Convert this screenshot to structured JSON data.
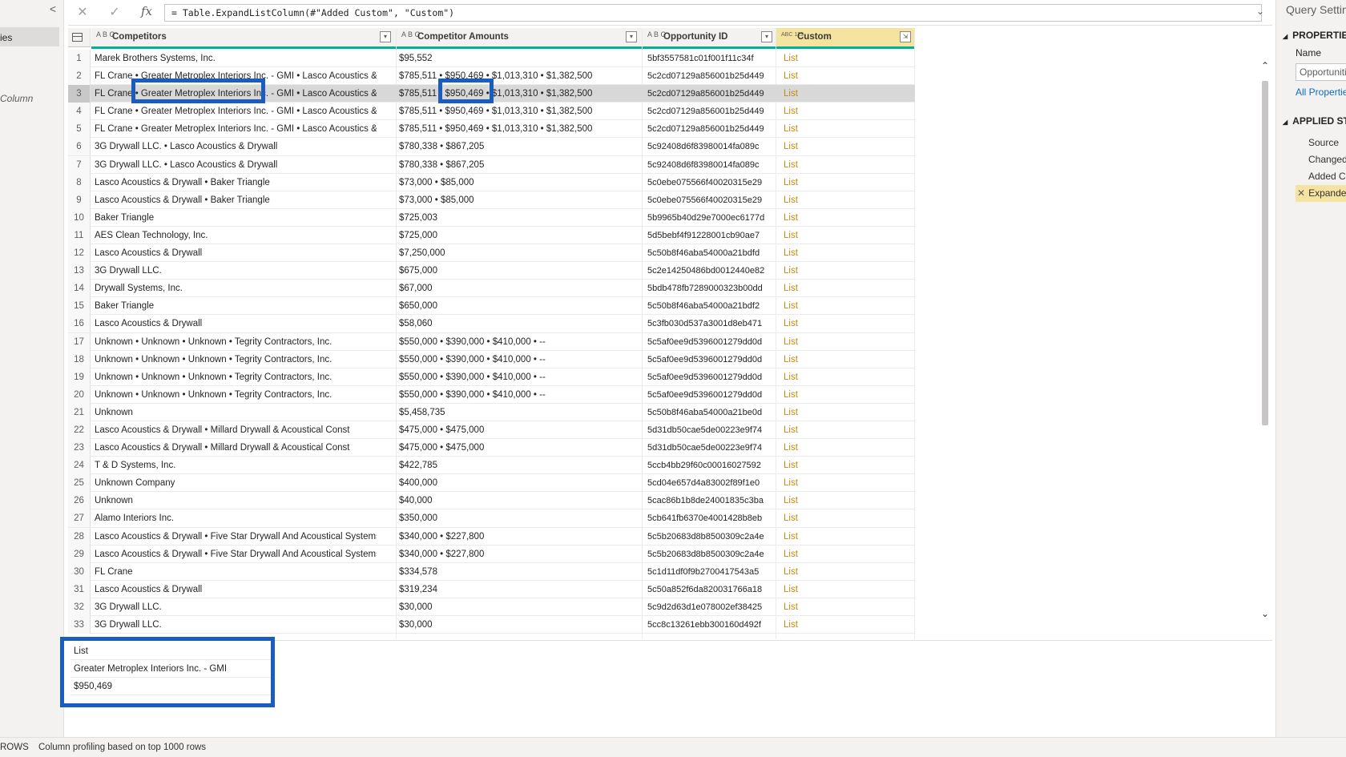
{
  "left_pane": {
    "collapse_glyph": "<",
    "partial_item": "ies",
    "partial_column": "Column"
  },
  "formula_bar": {
    "cancel_glyph": "✕",
    "commit_glyph": "✓",
    "fx_label": "fx",
    "formula": "= Table.ExpandListColumn(#\"Added Custom\", \"Custom\")",
    "expand_glyph": "⌄"
  },
  "columns": [
    {
      "name": "Competitors",
      "type_icon": "A B C",
      "bar_color": "#00b294"
    },
    {
      "name": "Competitor Amounts",
      "type_icon": "A B C",
      "bar_color": "#00b294"
    },
    {
      "name": "Opportunity ID",
      "type_icon": "A B C",
      "bar_color": "#00b294"
    },
    {
      "name": "Custom",
      "type_icon": "ABC 123",
      "bar_color": "#00b294",
      "header_bg": "#f5e3a0"
    }
  ],
  "rows": [
    {
      "idx": "1",
      "competitors": "Marek Brothers Systems, Inc.",
      "amounts": "$95,552",
      "opp_id": "5bf3557581c01f001f11c34f",
      "custom": "List"
    },
    {
      "idx": "2",
      "competitors": "FL Crane • Greater Metroplex Interiors  Inc. - GMI • Lasco Acoustics & ...",
      "amounts": "$785,511 • $950,469 • $1,013,310 • $1,382,500",
      "opp_id": "5c2cd07129a856001b25d449",
      "custom": "List"
    },
    {
      "idx": "3",
      "competitors": "FL Crane • Greater Metroplex Interiors  Inc. - GMI • Lasco Acoustics & ...",
      "amounts": "$785,511 • $950,469 • $1,013,310 • $1,382,500",
      "opp_id": "5c2cd07129a856001b25d449",
      "custom": "List"
    },
    {
      "idx": "4",
      "competitors": "FL Crane • Greater Metroplex Interiors  Inc. - GMI • Lasco Acoustics & ...",
      "amounts": "$785,511 • $950,469 • $1,013,310 • $1,382,500",
      "opp_id": "5c2cd07129a856001b25d449",
      "custom": "List"
    },
    {
      "idx": "5",
      "competitors": "FL Crane • Greater Metroplex Interiors  Inc. - GMI • Lasco Acoustics & ...",
      "amounts": "$785,511 • $950,469 • $1,013,310 • $1,382,500",
      "opp_id": "5c2cd07129a856001b25d449",
      "custom": "List"
    },
    {
      "idx": "6",
      "competitors": "3G Drywall LLC. • Lasco Acoustics & Drywall",
      "amounts": "$780,338 • $867,205",
      "opp_id": "5c92408d6f83980014fa089c",
      "custom": "List"
    },
    {
      "idx": "7",
      "competitors": "3G Drywall LLC. • Lasco Acoustics & Drywall",
      "amounts": "$780,338 • $867,205",
      "opp_id": "5c92408d6f83980014fa089c",
      "custom": "List"
    },
    {
      "idx": "8",
      "competitors": "Lasco Acoustics & Drywall • Baker Triangle",
      "amounts": "$73,000 • $85,000",
      "opp_id": "5c0ebe075566f40020315e29",
      "custom": "List"
    },
    {
      "idx": "9",
      "competitors": "Lasco Acoustics & Drywall • Baker Triangle",
      "amounts": "$73,000 • $85,000",
      "opp_id": "5c0ebe075566f40020315e29",
      "custom": "List"
    },
    {
      "idx": "10",
      "competitors": "Baker Triangle",
      "amounts": "$725,003",
      "opp_id": "5b9965b40d29e7000ec6177d",
      "custom": "List"
    },
    {
      "idx": "11",
      "competitors": "AES Clean Technology, Inc.",
      "amounts": "$725,000",
      "opp_id": "5d5bebf4f91228001cb90ae7",
      "custom": "List"
    },
    {
      "idx": "12",
      "competitors": "Lasco Acoustics & Drywall",
      "amounts": "$7,250,000",
      "opp_id": "5c50b8f46aba54000a21bdfd",
      "custom": "List"
    },
    {
      "idx": "13",
      "competitors": "3G Drywall LLC.",
      "amounts": "$675,000",
      "opp_id": "5c2e14250486bd0012440e82",
      "custom": "List"
    },
    {
      "idx": "14",
      "competitors": "Drywall Systems, Inc.",
      "amounts": "$67,000",
      "opp_id": "5bdb478fb7289000323b00dd",
      "custom": "List"
    },
    {
      "idx": "15",
      "competitors": "Baker Triangle",
      "amounts": "$650,000",
      "opp_id": "5c50b8f46aba54000a21bdf2",
      "custom": "List"
    },
    {
      "idx": "16",
      "competitors": "Lasco Acoustics & Drywall",
      "amounts": "$58,060",
      "opp_id": "5c3fb030d537a3001d8eb471",
      "custom": "List"
    },
    {
      "idx": "17",
      "competitors": "Unknown • Unknown • Unknown • Tegrity Contractors, Inc.",
      "amounts": "$550,000 • $390,000 • $410,000 • --",
      "opp_id": "5c5af0ee9d5396001279dd0d",
      "custom": "List"
    },
    {
      "idx": "18",
      "competitors": "Unknown • Unknown • Unknown • Tegrity Contractors, Inc.",
      "amounts": "$550,000 • $390,000 • $410,000 • --",
      "opp_id": "5c5af0ee9d5396001279dd0d",
      "custom": "List"
    },
    {
      "idx": "19",
      "competitors": "Unknown • Unknown • Unknown • Tegrity Contractors, Inc.",
      "amounts": "$550,000 • $390,000 • $410,000 • --",
      "opp_id": "5c5af0ee9d5396001279dd0d",
      "custom": "List"
    },
    {
      "idx": "20",
      "competitors": "Unknown • Unknown • Unknown • Tegrity Contractors, Inc.",
      "amounts": "$550,000 • $390,000 • $410,000 • --",
      "opp_id": "5c5af0ee9d5396001279dd0d",
      "custom": "List"
    },
    {
      "idx": "21",
      "competitors": "Unknown",
      "amounts": "$5,458,735",
      "opp_id": "5c50b8f46aba54000a21be0d",
      "custom": "List"
    },
    {
      "idx": "22",
      "competitors": "Lasco Acoustics & Drywall • Millard Drywall & Acoustical Const",
      "amounts": "$475,000 • $475,000",
      "opp_id": "5d31db50cae5de00223e9f74",
      "custom": "List"
    },
    {
      "idx": "23",
      "competitors": "Lasco Acoustics & Drywall • Millard Drywall & Acoustical Const",
      "amounts": "$475,000 • $475,000",
      "opp_id": "5d31db50cae5de00223e9f74",
      "custom": "List"
    },
    {
      "idx": "24",
      "competitors": "T & D Systems, Inc.",
      "amounts": "$422,785",
      "opp_id": "5ccb4bb29f60c00016027592",
      "custom": "List"
    },
    {
      "idx": "25",
      "competitors": "Unknown Company",
      "amounts": "$400,000",
      "opp_id": "5cd04e657d4a83002f89f1e0",
      "custom": "List"
    },
    {
      "idx": "26",
      "competitors": "Unknown",
      "amounts": "$40,000",
      "opp_id": "5cac86b1b8de24001835c3ba",
      "custom": "List"
    },
    {
      "idx": "27",
      "competitors": "Alamo Interiors Inc.",
      "amounts": "$350,000",
      "opp_id": "5cb641fb6370e4001428b8eb",
      "custom": "List"
    },
    {
      "idx": "28",
      "competitors": "Lasco Acoustics & Drywall • Five Star Drywall And Acoustical Systems, ...",
      "amounts": "$340,000 • $227,800",
      "opp_id": "5c5b20683d8b8500309c2a4e",
      "custom": "List"
    },
    {
      "idx": "29",
      "competitors": "Lasco Acoustics & Drywall • Five Star Drywall And Acoustical Systems, ...",
      "amounts": "$340,000 • $227,800",
      "opp_id": "5c5b20683d8b8500309c2a4e",
      "custom": "List"
    },
    {
      "idx": "30",
      "competitors": "FL Crane",
      "amounts": "$334,578",
      "opp_id": "5c1d11df0f9b2700417543a5",
      "custom": "List"
    },
    {
      "idx": "31",
      "competitors": "Lasco Acoustics & Drywall",
      "amounts": "$319,234",
      "opp_id": "5c50a852f6da820031766a18",
      "custom": "List"
    },
    {
      "idx": "32",
      "competitors": "3G Drywall LLC.",
      "amounts": "$30,000",
      "opp_id": "5c9d2d63d1e078002ef38425",
      "custom": "List"
    },
    {
      "idx": "33",
      "competitors": "3G Drywall LLC.",
      "amounts": "$30,000",
      "opp_id": "5cc8c13261ebb300160d492f",
      "custom": "List"
    }
  ],
  "preview": {
    "items": [
      "List",
      "Greater Metroplex Interiors Inc. - GMI",
      "$950,469"
    ]
  },
  "scrollbar": {
    "up_glyph": "⌃",
    "down_glyph": "⌄"
  },
  "right_pane": {
    "title": "Query Settings",
    "properties_header": "PROPERTIES",
    "name_label": "Name",
    "name_value": "Opportunities",
    "all_properties_link": "All Properties",
    "applied_steps_header": "APPLIED STEPS",
    "steps": [
      "Source",
      "Changed Type",
      "Added Custom",
      "Expanded Custom"
    ],
    "active_step_index": 3
  },
  "status_bar": {
    "rows_label": "ROWS",
    "profiling_text": "Column profiling based on top 1000 rows"
  },
  "colors": {
    "accent_blue": "#1a5dbf",
    "list_link": "#c28a0e",
    "quality_bar": "#00b294"
  }
}
